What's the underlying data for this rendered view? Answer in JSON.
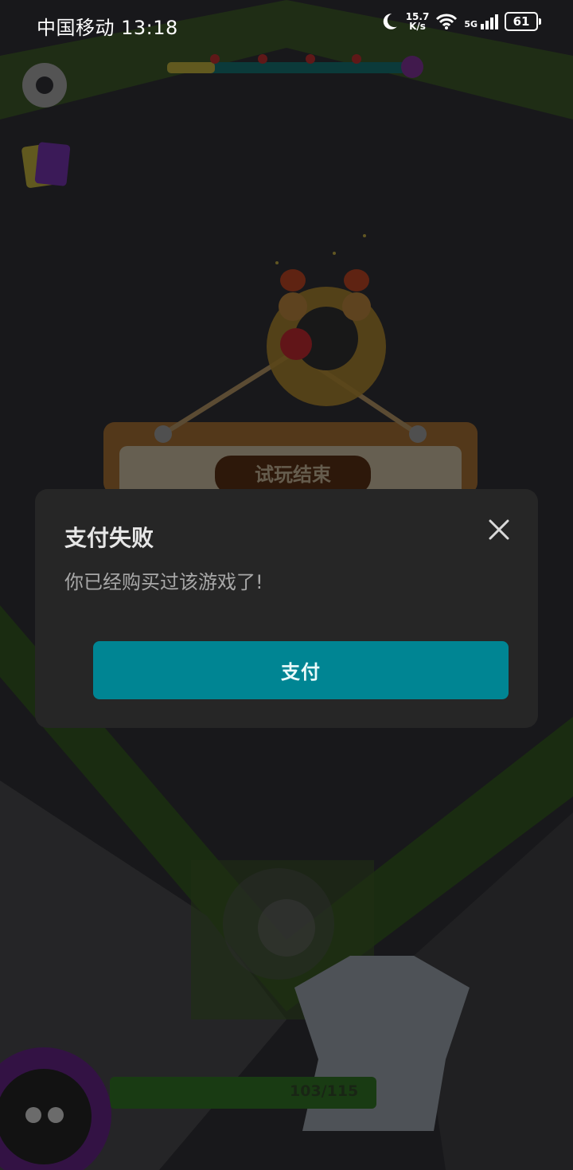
{
  "status_bar": {
    "carrier_time": "中国移动 13:18",
    "net_speed_value": "15.7",
    "net_speed_unit": "K/s",
    "signal_label": "5G",
    "battery": "61"
  },
  "game": {
    "sign_text": "试玩结束",
    "hp_text": "103/115",
    "hp_fraction": 0.896
  },
  "dialog": {
    "title": "支付失败",
    "message": "你已经购买过该游戏了!",
    "pay_button": "支付"
  },
  "colors": {
    "dialog_bg": "#262626",
    "pay_button_bg": "#008593",
    "dim_overlay": "rgba(0,0,0,0.58)"
  }
}
